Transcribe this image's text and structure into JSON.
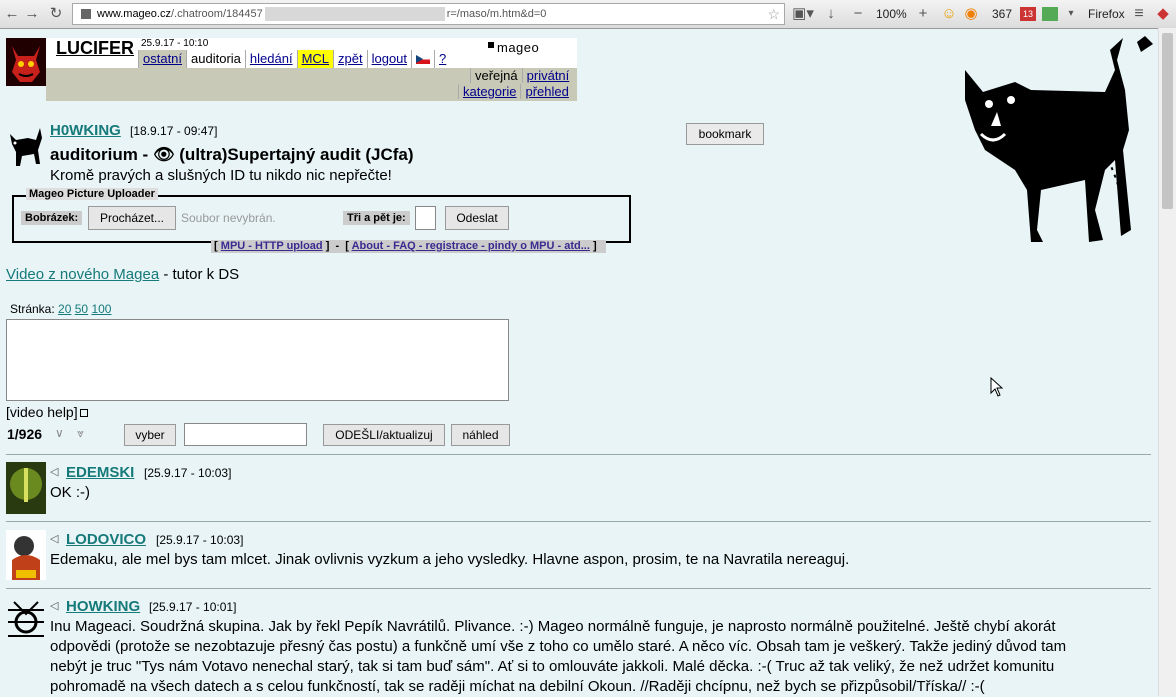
{
  "browser": {
    "url_domain": "www.mageo.cz",
    "url_prefix": "/.chatroom/184457",
    "url_suffix": "r=/maso/m.htm&d=0",
    "zoom": "100%",
    "badge_count": "367",
    "notif_count": "13",
    "firefox_label": "Firefox"
  },
  "header": {
    "nick": "LUCIFER",
    "datetime": "25.9.17 - 10:10",
    "logo": "mageo",
    "nav": [
      "ostatní",
      "auditoria",
      "hledání",
      "MCL",
      "zpět",
      "logout",
      "?"
    ],
    "nav2": [
      "veřejná",
      "privátní"
    ],
    "nav3": [
      "kategorie",
      "přehled"
    ]
  },
  "room": {
    "owner": "H0WKING",
    "owner_date": "[18.9.17 - 09:47]",
    "title_prefix": "auditorium - ",
    "title_icon": "👁",
    "title_rest": " (ultra)Supertajný audit (JCfa)",
    "description": "Kromě pravých a slušných ID tu nikdo nic nepřečte!",
    "bookmark": "bookmark"
  },
  "uploader": {
    "legend": "Mageo Picture Uploader",
    "image_label": "Bobrázek:",
    "browse": "Procházet...",
    "no_file": "Soubor nevybrán.",
    "captcha_label": "Tři a pět je:",
    "send": "Odeslat",
    "mpu_link1": "MPU - HTTP upload",
    "mpu_link2": "About - FAQ - registrace - pindy o MPU - atd..."
  },
  "intro": {
    "video_link": "Video z nového Magea",
    "video_rest": " - tutor k DS",
    "page_label": "Stránka:",
    "page_sizes": [
      "20",
      "50",
      "100"
    ],
    "video_help": "[video help]",
    "count": "1/926",
    "pick": "vyber",
    "send_refresh": "ODEŠLI/aktualizuj",
    "preview": "náhled"
  },
  "posts": [
    {
      "author": "EDEMSKI",
      "date": "[25.9.17 - 10:03]",
      "text": [
        "OK :-)"
      ]
    },
    {
      "author": "LODOVICO",
      "date": "[25.9.17 - 10:03]",
      "text": [
        "Edemaku, ale mel bys tam mlcet. Jinak ovlivnis vyzkum a jeho vysledky. Hlavne aspon, prosim, te na Navratila nereaguj."
      ]
    },
    {
      "author": "HOWKING",
      "date": "[25.9.17 - 10:01]",
      "text": [
        "Inu Mageaci. Soudržná skupina. Jak by řekl Pepík Navrátilů. Plivance. :-) Mageo normálně funguje, je naprosto normálně použitelné. Ještě chybí akorát",
        "odpovědi (protože se nezobtazuje přesný čas postu) a funkčně umí vše z toho co umělo staré. A něco víc. Obsah tam je veškerý. Takže jediný důvod tam",
        "nebýt je truc \"Tys nám Votavo nenechal starý, tak si tam buď sám\". Ať si to omlouváte jakkoli. Malé děcka. :-( Truc až tak veliký, že než udržet komunitu",
        "pohromadě na všech datech a s celou funkčností, tak se raději míchat na debilní Okoun. //Raději chcípnu, než bych se přizpůsobil/Tříska// :-("
      ]
    }
  ],
  "colors": {
    "page_bg": "#e8f4f6",
    "link_teal": "#167a7a",
    "nav_grey": "#c9c9b8",
    "mcl_yellow": "#ffff00"
  }
}
